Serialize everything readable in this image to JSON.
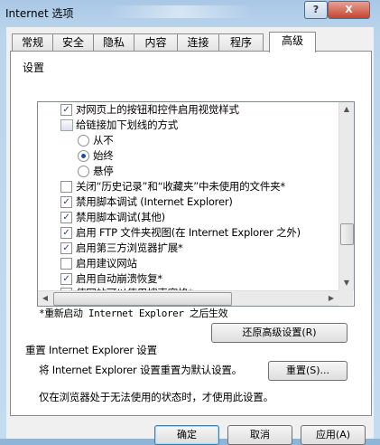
{
  "window": {
    "title": "Internet 选项",
    "help_label": "?",
    "close_label": "X"
  },
  "tabs": [
    {
      "label": "常规"
    },
    {
      "label": "安全"
    },
    {
      "label": "隐私"
    },
    {
      "label": "内容"
    },
    {
      "label": "连接"
    },
    {
      "label": "程序"
    },
    {
      "label": "高级"
    }
  ],
  "active_tab": "高级",
  "settings": {
    "group_label": "设置",
    "items": [
      {
        "kind": "checkbox",
        "checked": true,
        "label": "对网页上的按钮和控件启用视觉样式"
      },
      {
        "kind": "group",
        "label": "给链接加下划线的方式"
      },
      {
        "kind": "radio",
        "checked": false,
        "label": "从不"
      },
      {
        "kind": "radio",
        "checked": true,
        "label": "始终"
      },
      {
        "kind": "radio",
        "checked": false,
        "label": "悬停"
      },
      {
        "kind": "checkbox",
        "checked": false,
        "label": "关闭“历史记录”和“收藏夹”中未使用的文件夹*"
      },
      {
        "kind": "checkbox",
        "checked": true,
        "label": "禁用脚本调试 (Internet Explorer)"
      },
      {
        "kind": "checkbox",
        "checked": true,
        "label": "禁用脚本调试(其他)"
      },
      {
        "kind": "checkbox",
        "checked": true,
        "label": "启用 FTP 文件夹视图(在 Internet Explorer 之外)"
      },
      {
        "kind": "checkbox",
        "checked": true,
        "label": "启用第三方浏览器扩展*"
      },
      {
        "kind": "checkbox",
        "checked": false,
        "label": "启用建议网站"
      },
      {
        "kind": "checkbox",
        "checked": true,
        "label": "启用自动崩溃恢复*"
      },
      {
        "kind": "checkbox",
        "checked": false,
        "label": "使网站可以使用搜索窗格*"
      }
    ],
    "restart_note": "*重新启动 Internet Explorer 之后生效",
    "restore_button": "还原高级设置(R)"
  },
  "reset": {
    "title": "重置 Internet Explorer 设置",
    "description": "将 Internet Explorer 设置重置为默认设置。",
    "button": "重置(S)...",
    "note": "仅在浏览器处于无法使用的状态时，才使用此设置。"
  },
  "footer": {
    "ok": "确定",
    "cancel": "取消",
    "apply": "应用(A)"
  }
}
